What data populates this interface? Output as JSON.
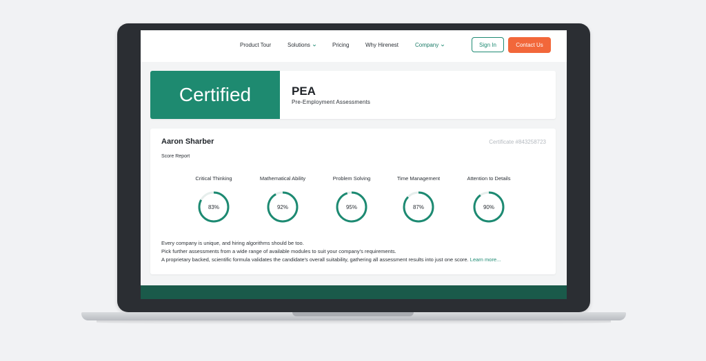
{
  "nav": {
    "items": [
      {
        "label": "Product Tour",
        "dropdown": false,
        "active": false
      },
      {
        "label": "Solutions",
        "dropdown": true,
        "active": false
      },
      {
        "label": "Pricing",
        "dropdown": false,
        "active": false
      },
      {
        "label": "Why Hirenest",
        "dropdown": false,
        "active": false
      },
      {
        "label": "Company",
        "dropdown": true,
        "active": true
      }
    ],
    "sign_in": "Sign In",
    "contact_us": "Contact Us"
  },
  "certificate": {
    "badge": "Certified",
    "title": "PEA",
    "subtitle": "Pre-Employment Assessments"
  },
  "report": {
    "name": "Aaron Sharber",
    "certificate_number": "Certificate #843258723",
    "section_label": "Score Report",
    "metrics": [
      {
        "label": "Critical Thinking",
        "percent": 83,
        "display": "83%"
      },
      {
        "label": "Mathematical Ability",
        "percent": 92,
        "display": "92%"
      },
      {
        "label": "Problem Solving",
        "percent": 95,
        "display": "95%"
      },
      {
        "label": "Time Management",
        "percent": 87,
        "display": "87%"
      },
      {
        "label": "Attention to Details",
        "percent": 90,
        "display": "90%"
      }
    ],
    "description": [
      "Every company is unique, and hiring algorithms should be too.",
      "Pick further assessments from a wide range of available modules to suit your company's requirements.",
      "A proprietary backed, scientific formula validates the candidate's overall suitability, gathering all assessment results into just one score."
    ],
    "learn_more": "Learn more..."
  },
  "colors": {
    "brand_green": "#1e8a70",
    "ring_green": "#1d8a72",
    "accent_orange": "#f2673a",
    "footer_green": "#1a5a4a"
  }
}
